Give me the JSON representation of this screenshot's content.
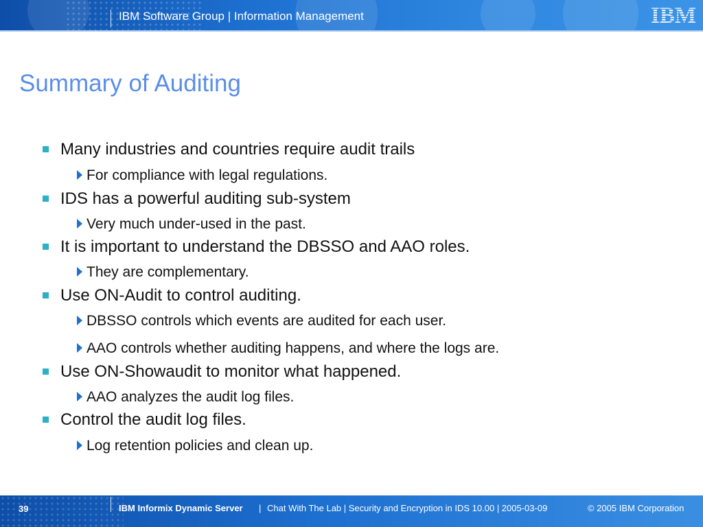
{
  "header": {
    "title": "IBM Software Group | Information Management",
    "logo_text": "IBM"
  },
  "slide": {
    "title": "Summary of Auditing",
    "bullets": [
      {
        "text": "Many industries and countries require audit trails",
        "subs": [
          "For compliance with legal regulations."
        ]
      },
      {
        "text": "IDS has a powerful auditing sub-system",
        "subs": [
          "Very much under-used in the past."
        ]
      },
      {
        "text": "It is important to understand the DBSSO and AAO roles.",
        "subs": [
          "They are complementary."
        ]
      },
      {
        "text": "Use ON-Audit to control auditing.",
        "subs": [
          "DBSSO controls which events are audited for each user.",
          "AAO controls whether auditing happens, and where the logs are."
        ]
      },
      {
        "text": "Use ON-Showaudit to monitor what happened.",
        "subs": [
          "AAO analyzes the audit log files."
        ]
      },
      {
        "text": "Control the audit log files.",
        "subs": [
          "Log retention policies and clean up."
        ]
      }
    ]
  },
  "footer": {
    "page_number": "39",
    "product": "IBM Informix Dynamic Server",
    "separator": "|",
    "text": "Chat With The Lab | Security and Encryption in IDS 10.00 | 2005-03-09",
    "copyright": "© 2005 IBM Corporation"
  },
  "colors": {
    "header_blue": "#1d6fd0",
    "title_blue": "#5b8ee6",
    "bullet_teal": "#2bb0c8",
    "sub_arrow_blue": "#1d6fd0"
  },
  "icons": {
    "bullet": "square-bullet-icon",
    "sub_bullet": "triangle-right-icon"
  }
}
